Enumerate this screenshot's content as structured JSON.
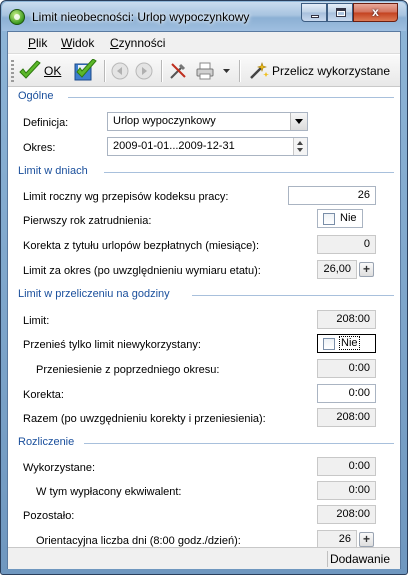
{
  "window": {
    "title": "Limit nieobecności: Urlop wypoczynkowy",
    "close_glyph": "x"
  },
  "menu": {
    "items": [
      {
        "label": "Plik",
        "hotkey": "P"
      },
      {
        "label": "Widok",
        "hotkey": "W"
      },
      {
        "label": "Czynności",
        "hotkey": "C"
      }
    ]
  },
  "toolbar": {
    "ok_label": "OK",
    "recalc_label": "Przelicz wykorzystane"
  },
  "ogolne": {
    "heading": "Ogólne",
    "definicja_label": "Definicja:",
    "definicja_value": "Urlop wypoczynkowy",
    "okres_label": "Okres:",
    "okres_value": "2009-01-01...2009-12-31"
  },
  "limit_dni": {
    "heading": "Limit w dniach",
    "roczny_label": "Limit roczny wg przepisów kodeksu pracy:",
    "roczny_value": "26",
    "pierwszy_label": "Pierwszy rok zatrudnienia:",
    "pierwszy_checked": false,
    "pierwszy_text": "Nie",
    "korekta_label": "Korekta z tytułu urlopów bezpłatnych (miesiące):",
    "korekta_value": "0",
    "za_okres_label": "Limit za okres (po uwzględnieniu wymiaru etatu):",
    "za_okres_value": "26,00"
  },
  "limit_godziny": {
    "heading": "Limit w przeliczeniu na godziny",
    "limit_label": "Limit:",
    "limit_value": "208:00",
    "przenies_label": "Przenieś tylko limit niewykorzystany:",
    "przenies_checked": false,
    "przenies_text": "Nie",
    "przeniesienie_label": "Przeniesienie z poprzedniego okresu:",
    "przeniesienie_value": "0:00",
    "korekta_label": "Korekta:",
    "korekta_value": "0:00",
    "razem_label": "Razem (po uwzgędnieniu korekty i przeniesienia):",
    "razem_value": "208:00"
  },
  "rozliczenie": {
    "heading": "Rozliczenie",
    "wykorzystane_label": "Wykorzystane:",
    "wykorzystane_value": "0:00",
    "ekwiwalent_label": "W tym wypłacony ekwiwalent:",
    "ekwiwalent_value": "0:00",
    "pozostalo_label": "Pozostało:",
    "pozostalo_value": "208:00",
    "orientacyjna_label": "Orientacyjna liczba dni (8:00 godz./dzień):",
    "orientacyjna_value": "26"
  },
  "status": {
    "mode": "Dodawanie"
  },
  "colors": {
    "section_heading": "#1a4f9c",
    "readonly_field_bg": "#f0f0f0",
    "title_bar": "#a8c4e0"
  }
}
